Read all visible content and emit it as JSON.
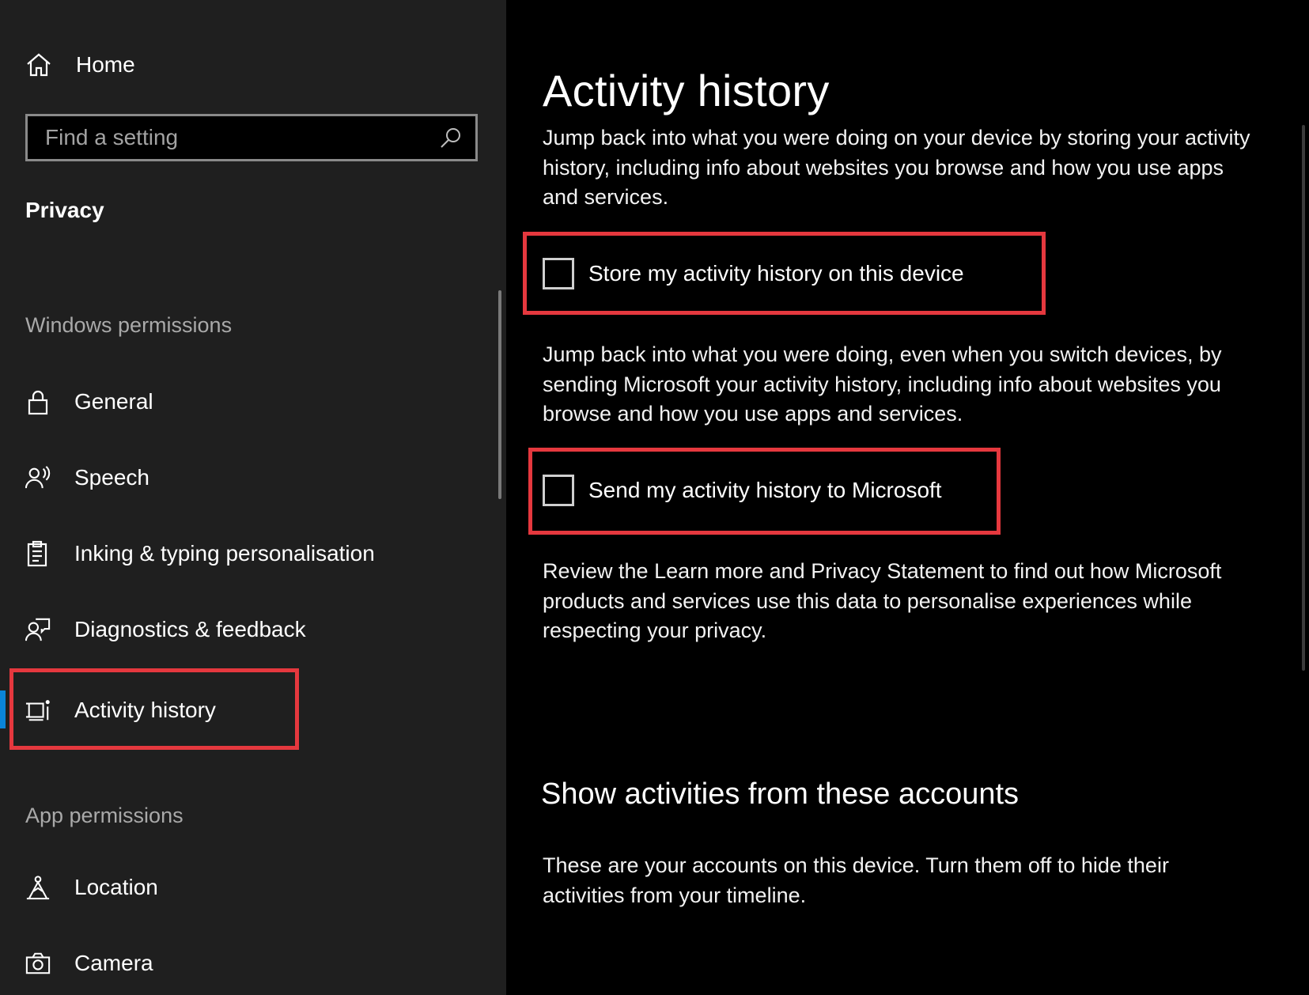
{
  "sidebar": {
    "home_label": "Home",
    "search_placeholder": "Find a setting",
    "section_title": "Privacy",
    "windows_permissions_label": "Windows permissions",
    "windows_items": [
      {
        "label": "General",
        "icon": "lock-icon"
      },
      {
        "label": "Speech",
        "icon": "speech-icon"
      },
      {
        "label": "Inking & typing personalisation",
        "icon": "clipboard-icon"
      },
      {
        "label": "Diagnostics & feedback",
        "icon": "feedback-icon"
      },
      {
        "label": "Activity history",
        "icon": "timeline-icon",
        "selected": true
      }
    ],
    "app_permissions_label": "App permissions",
    "app_items": [
      {
        "label": "Location",
        "icon": "location-icon"
      },
      {
        "label": "Camera",
        "icon": "camera-icon"
      }
    ]
  },
  "main": {
    "title": "Activity history",
    "intro": "Jump back into what you were doing on your device by storing your activity history, including info about websites you browse and how you use apps and services.",
    "store_checkbox": {
      "label": "Store my activity history on this device",
      "checked": false
    },
    "send_intro": "Jump back into what you were doing, even when you switch devices, by sending Microsoft your activity history, including info about websites you browse and how you use apps and services.",
    "send_checkbox": {
      "label": "Send my activity history to Microsoft",
      "checked": false
    },
    "review_text": "Review the Learn more and Privacy Statement to find out how Microsoft products and services use this data to personalise experiences while respecting your privacy.",
    "accounts_title": "Show activities from these accounts",
    "accounts_text": "These are your accounts on this device. Turn them off to hide their activities from your timeline."
  },
  "colors": {
    "sidebar_bg": "#1f1f1f",
    "main_bg": "#000000",
    "accent": "#0a84d8",
    "highlight_box": "#e5383e"
  }
}
